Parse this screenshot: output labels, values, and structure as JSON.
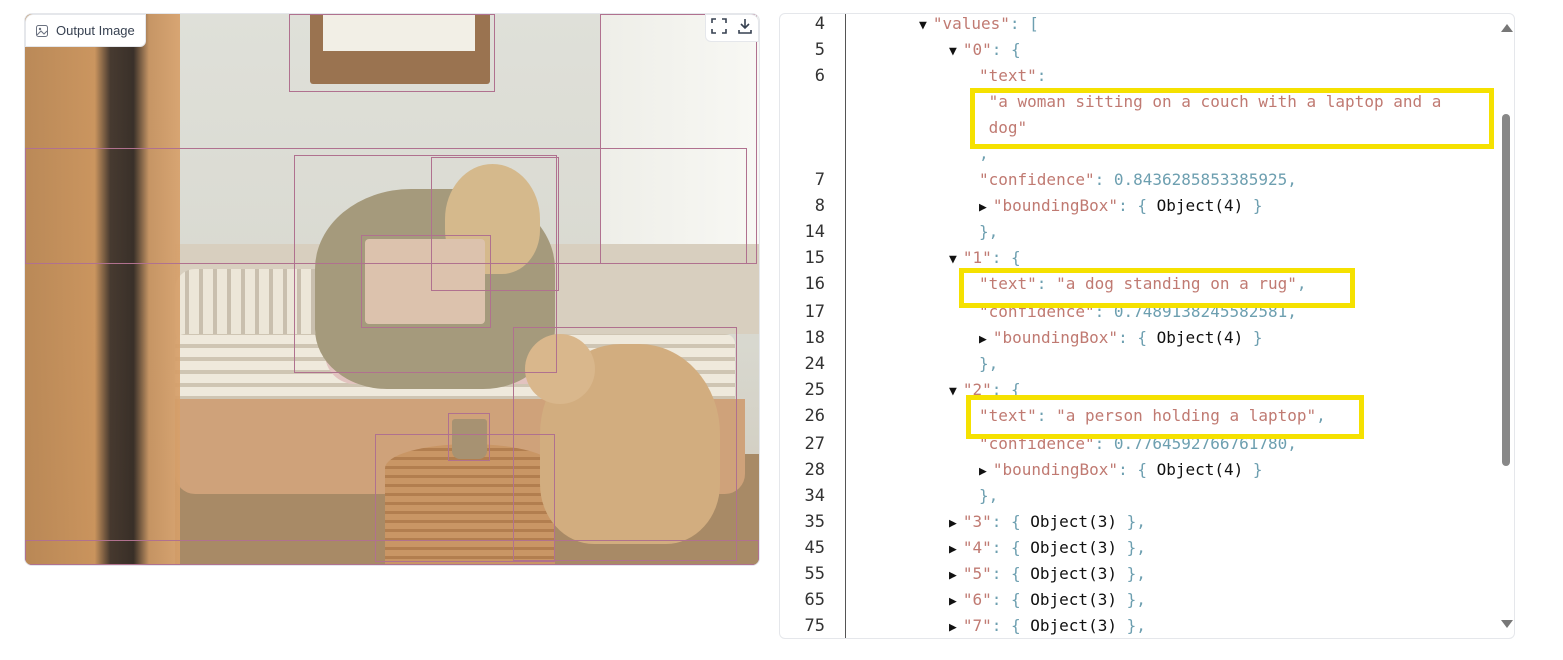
{
  "image_panel": {
    "label": "Output Image",
    "label_icon": "image-icon",
    "fullscreen_icon": "fullscreen-icon",
    "download_icon": "download-icon",
    "box_color": "#b0718f"
  },
  "code_view": {
    "highlight_color": "#f5e100",
    "lines": [
      {
        "n": "4",
        "indent": 4,
        "toggle": "open",
        "parts": [
          [
            "key",
            "\"values\""
          ],
          [
            "punc",
            ": ["
          ]
        ]
      },
      {
        "n": "5",
        "indent": 5,
        "toggle": "open",
        "parts": [
          [
            "key",
            "\"0\""
          ],
          [
            "punc",
            ": {"
          ]
        ]
      },
      {
        "n": "6",
        "indent": 6,
        "toggle": null,
        "parts": [
          [
            "key",
            "\"text\""
          ],
          [
            "punc",
            ":"
          ]
        ]
      },
      {
        "n": "",
        "indent": 6,
        "toggle": null,
        "parts": [
          [
            "str",
            " \"a woman sitting on a couch with a laptop and a"
          ]
        ]
      },
      {
        "n": "",
        "indent": 6,
        "toggle": null,
        "parts": [
          [
            "str",
            " dog\""
          ]
        ]
      },
      {
        "n": "",
        "indent": 6,
        "toggle": null,
        "parts": [
          [
            "punc",
            ","
          ]
        ]
      },
      {
        "n": "7",
        "indent": 6,
        "toggle": null,
        "parts": [
          [
            "key",
            "\"confidence\""
          ],
          [
            "punc",
            ": "
          ],
          [
            "num",
            "0.8436285853385925"
          ],
          [
            "punc",
            ","
          ]
        ]
      },
      {
        "n": "8",
        "indent": 6,
        "toggle": "closed",
        "parts": [
          [
            "key",
            "\"boundingBox\""
          ],
          [
            "punc",
            ": { "
          ],
          [
            "obj",
            "Object(4)"
          ],
          [
            "punc",
            " }"
          ]
        ]
      },
      {
        "n": "14",
        "indent": 6,
        "toggle": null,
        "parts": [
          [
            "punc",
            "},"
          ]
        ]
      },
      {
        "n": "15",
        "indent": 5,
        "toggle": "open",
        "parts": [
          [
            "key",
            "\"1\""
          ],
          [
            "punc",
            ": {"
          ]
        ]
      },
      {
        "n": "16",
        "indent": 6,
        "toggle": null,
        "parts": [
          [
            "key",
            "\"text\""
          ],
          [
            "punc",
            ": "
          ],
          [
            "str",
            "\"a dog standing on a rug\""
          ],
          [
            "punc",
            ","
          ]
        ]
      },
      {
        "n": "17",
        "indent": 6,
        "toggle": null,
        "parts": [
          [
            "key",
            "\"confidence\""
          ],
          [
            "punc",
            ": "
          ],
          [
            "num",
            "0.7489138245582581"
          ],
          [
            "punc",
            ","
          ]
        ]
      },
      {
        "n": "18",
        "indent": 6,
        "toggle": "closed",
        "parts": [
          [
            "key",
            "\"boundingBox\""
          ],
          [
            "punc",
            ": { "
          ],
          [
            "obj",
            "Object(4)"
          ],
          [
            "punc",
            " }"
          ]
        ]
      },
      {
        "n": "24",
        "indent": 6,
        "toggle": null,
        "parts": [
          [
            "punc",
            "},"
          ]
        ]
      },
      {
        "n": "25",
        "indent": 5,
        "toggle": "open",
        "parts": [
          [
            "key",
            "\"2\""
          ],
          [
            "punc",
            ": {"
          ]
        ]
      },
      {
        "n": "26",
        "indent": 6,
        "toggle": null,
        "parts": [
          [
            "key",
            "\"text\""
          ],
          [
            "punc",
            ": "
          ],
          [
            "str",
            "\"a person holding a laptop\""
          ],
          [
            "punc",
            ","
          ]
        ]
      },
      {
        "n": "27",
        "indent": 6,
        "toggle": null,
        "parts": [
          [
            "key",
            "\"confidence\""
          ],
          [
            "punc",
            ": "
          ],
          [
            "num",
            "0.7764592766761780"
          ],
          [
            "punc",
            ","
          ]
        ]
      },
      {
        "n": "28",
        "indent": 6,
        "toggle": "closed",
        "parts": [
          [
            "key",
            "\"boundingBox\""
          ],
          [
            "punc",
            ": { "
          ],
          [
            "obj",
            "Object(4)"
          ],
          [
            "punc",
            " }"
          ]
        ]
      },
      {
        "n": "34",
        "indent": 6,
        "toggle": null,
        "parts": [
          [
            "punc",
            "},"
          ]
        ]
      },
      {
        "n": "35",
        "indent": 5,
        "toggle": "closed",
        "parts": [
          [
            "key",
            "\"3\""
          ],
          [
            "punc",
            ": { "
          ],
          [
            "obj",
            "Object(3)"
          ],
          [
            "punc",
            " },"
          ]
        ]
      },
      {
        "n": "45",
        "indent": 5,
        "toggle": "closed",
        "parts": [
          [
            "key",
            "\"4\""
          ],
          [
            "punc",
            ": { "
          ],
          [
            "obj",
            "Object(3)"
          ],
          [
            "punc",
            " },"
          ]
        ]
      },
      {
        "n": "55",
        "indent": 5,
        "toggle": "closed",
        "parts": [
          [
            "key",
            "\"5\""
          ],
          [
            "punc",
            ": { "
          ],
          [
            "obj",
            "Object(3)"
          ],
          [
            "punc",
            " },"
          ]
        ]
      },
      {
        "n": "65",
        "indent": 5,
        "toggle": "closed",
        "parts": [
          [
            "key",
            "\"6\""
          ],
          [
            "punc",
            ": { "
          ],
          [
            "obj",
            "Object(3)"
          ],
          [
            "punc",
            " },"
          ]
        ]
      },
      {
        "n": "75",
        "indent": 5,
        "toggle": "closed",
        "parts": [
          [
            "key",
            "\"7\""
          ],
          [
            "punc",
            ": { "
          ],
          [
            "obj",
            "Object(3)"
          ],
          [
            "punc",
            " },"
          ]
        ]
      }
    ]
  }
}
